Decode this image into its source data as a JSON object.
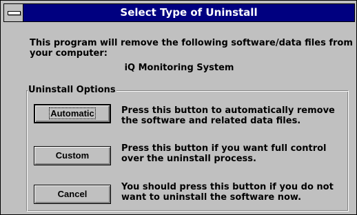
{
  "window": {
    "title": "Select Type of Uninstall",
    "system_menu_icon": "system-menu-icon"
  },
  "description": "This program will remove the following software/data files from your computer:",
  "product_name": "iQ Monitoring System",
  "group": {
    "label": "Uninstall Options",
    "options": [
      {
        "button_label": "Automatic",
        "description": "Press this button to automatically remove the software and related data files."
      },
      {
        "button_label": "Custom",
        "description": "Press this button if you want full control over the uninstall process."
      },
      {
        "button_label": "Cancel",
        "description": "You should press this button if you do not want to uninstall the software now."
      }
    ]
  },
  "colors": {
    "titlebar": "#000080",
    "face": "#c0c0c0"
  }
}
